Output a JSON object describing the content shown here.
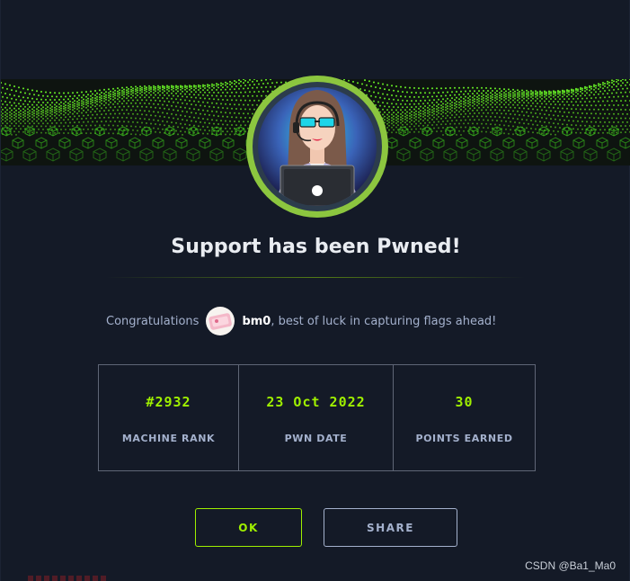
{
  "modal": {
    "title": "Support has been Pwned!",
    "congrats_prefix": "Congratulations",
    "username": "bm0",
    "congrats_suffix": ", best of luck in capturing flags ahead!",
    "banner_icon": "green-cube-grid-wave",
    "avatar_icon": "support-agent-avatar",
    "accent_color": "#9fef00",
    "avatar_ring_color": "#8cc63f"
  },
  "stats": [
    {
      "value": "#2932",
      "label": "MACHINE RANK"
    },
    {
      "value": "23 Oct 2022",
      "label": "PWN DATE"
    },
    {
      "value": "30",
      "label": "POINTS EARNED"
    }
  ],
  "buttons": {
    "ok_label": "OK",
    "share_label": "SHARE"
  },
  "watermark": "CSDN @Ba1_Ma0"
}
